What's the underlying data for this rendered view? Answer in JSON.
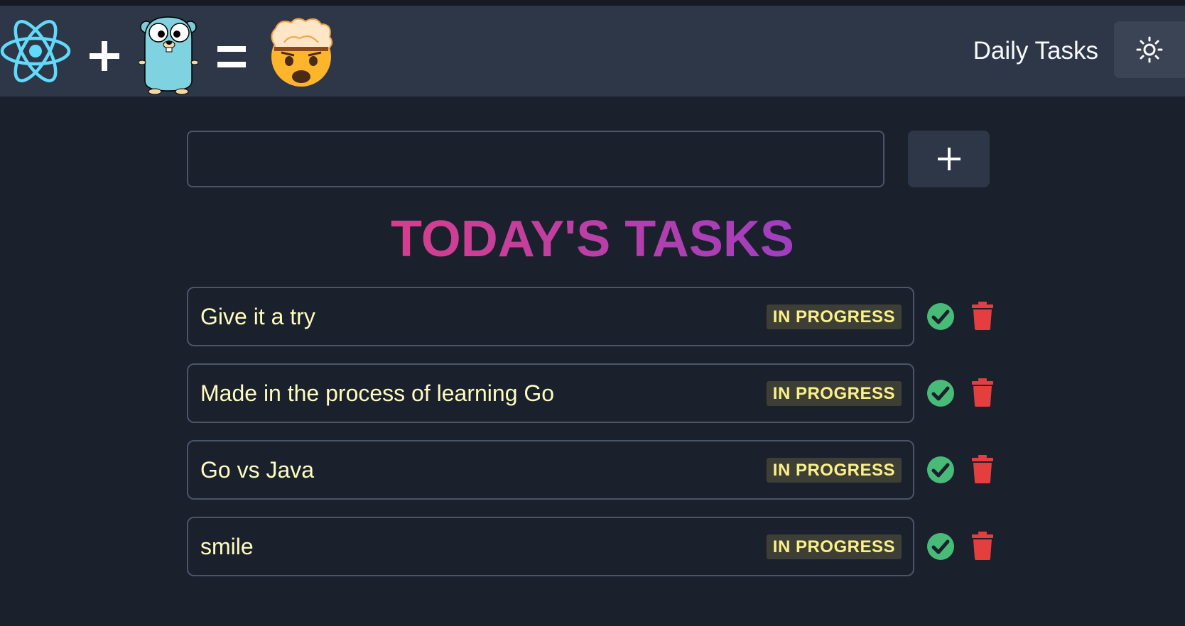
{
  "header": {
    "logo_icons": [
      "react-icon",
      "plus-operator-icon",
      "gopher-icon",
      "equals-operator-icon",
      "mind-blown-icon"
    ],
    "title": "Daily Tasks",
    "theme_toggle_icon": "sun-icon"
  },
  "add_task": {
    "input_value": "",
    "input_placeholder": "",
    "add_button_icon": "plus-icon"
  },
  "heading": "TODAY'S TASKS",
  "tasks": [
    {
      "text": "Give it a try",
      "status": "IN PROGRESS"
    },
    {
      "text": "Made in the process of learning Go",
      "status": "IN PROGRESS"
    },
    {
      "text": "Go vs Java",
      "status": "IN PROGRESS"
    },
    {
      "text": "smile",
      "status": "IN PROGRESS"
    }
  ],
  "colors": {
    "background": "#1a202c",
    "navbar": "#2d3748",
    "heading_gradient_start": "#d53f8c",
    "heading_gradient_end": "#9f3fbf",
    "badge_text": "#faf089",
    "check_green": "#48bb78",
    "delete_red": "#e53e3e"
  }
}
